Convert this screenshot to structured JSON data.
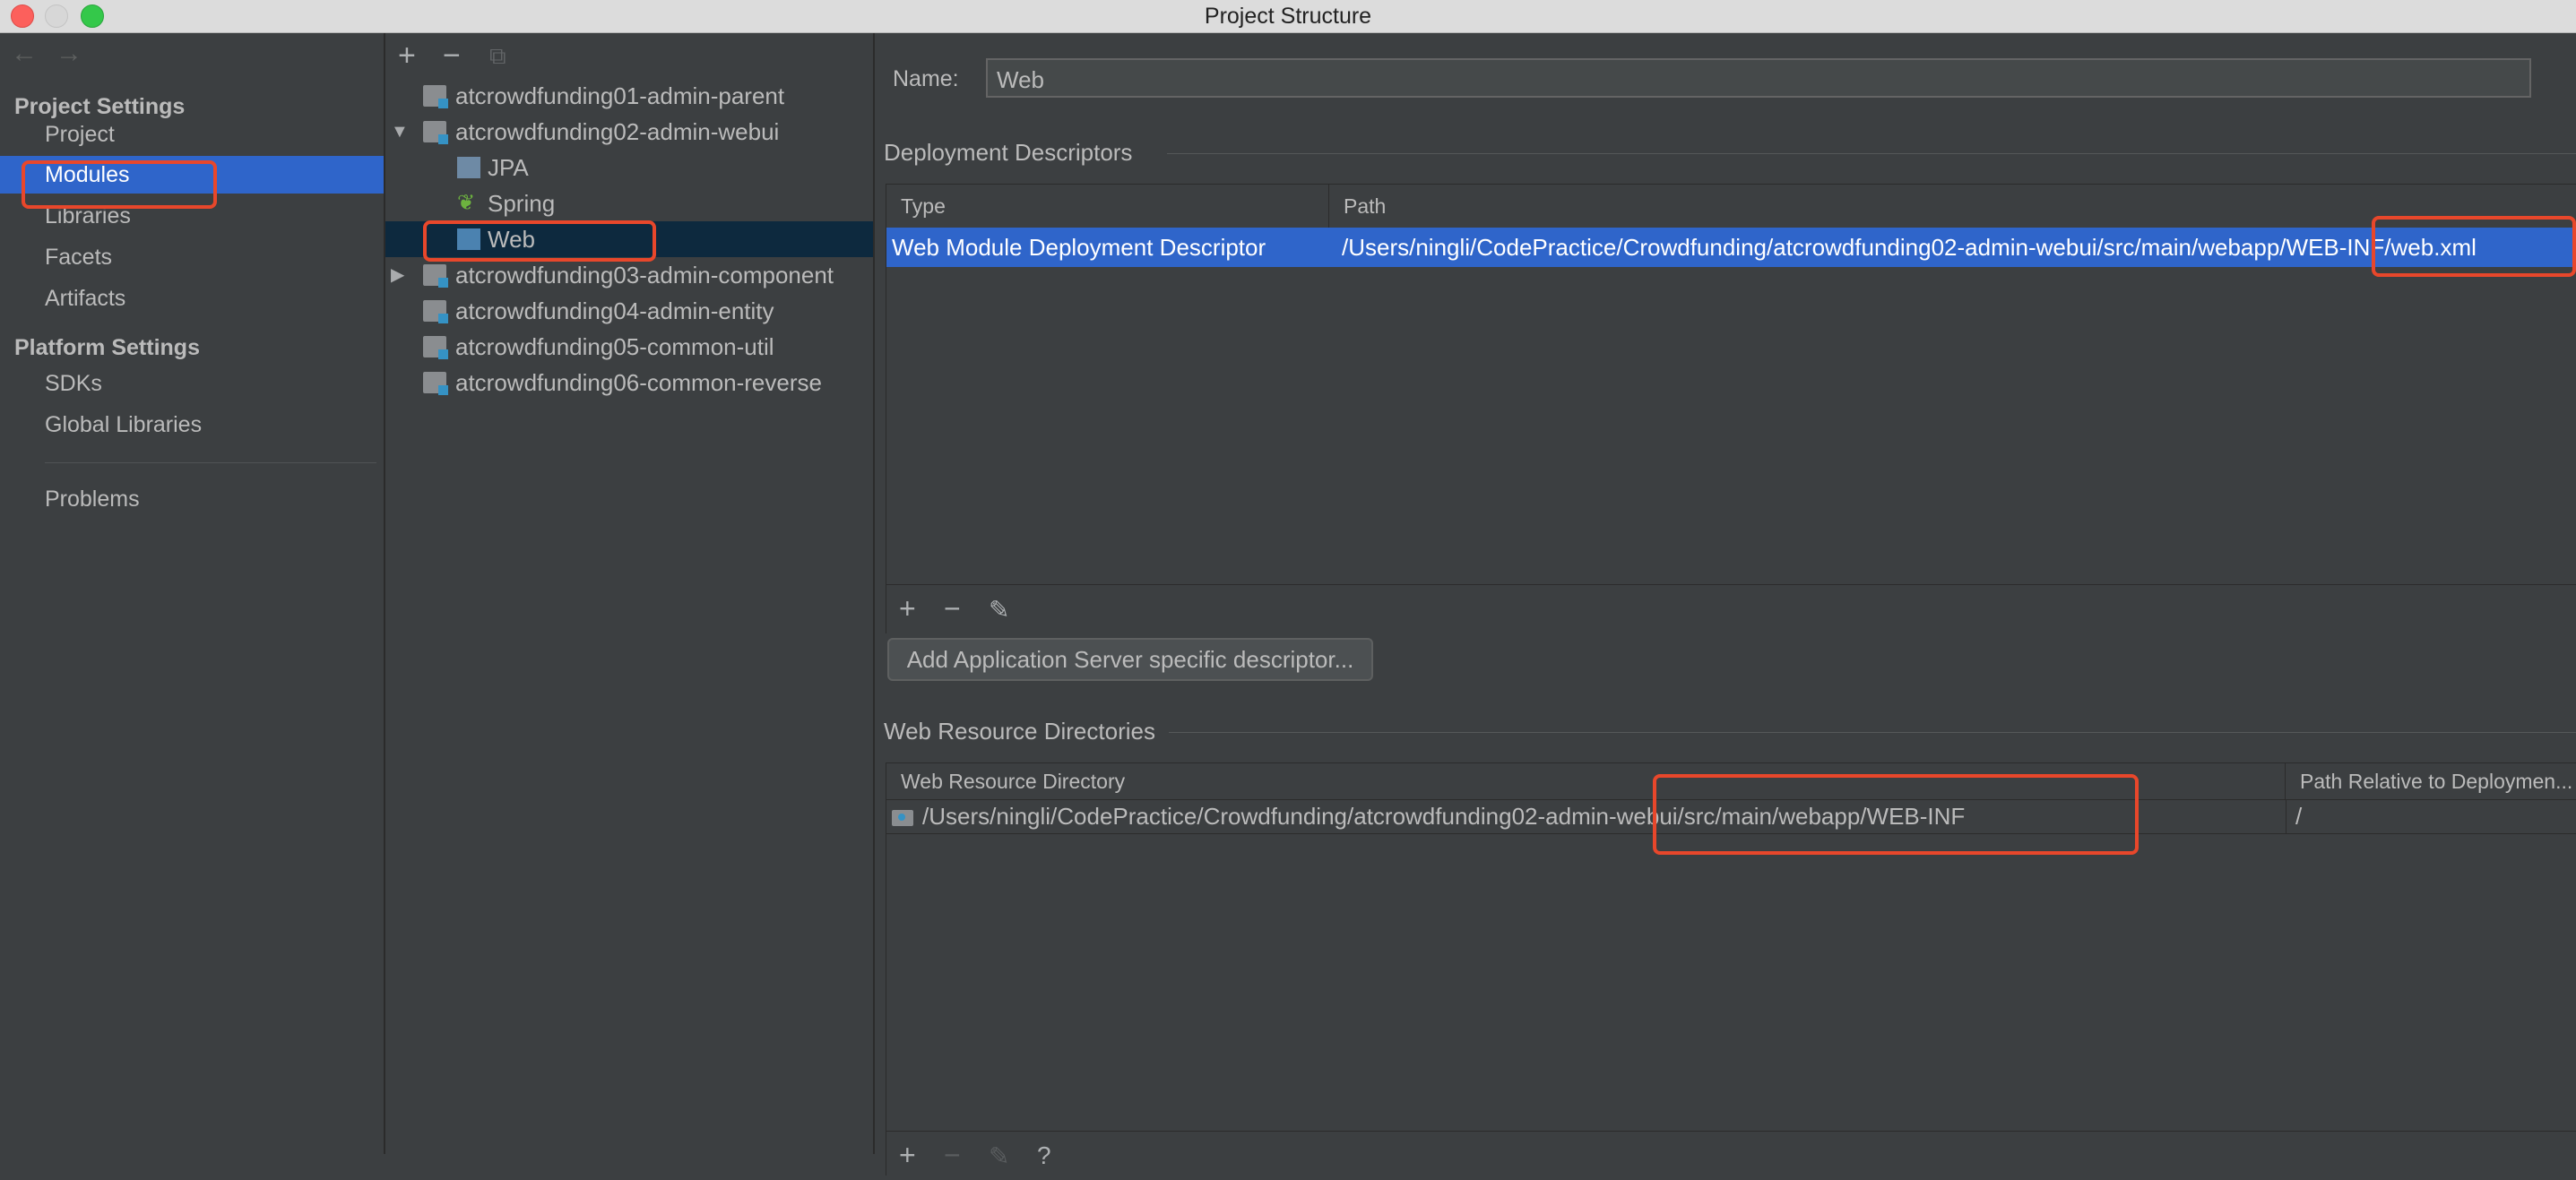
{
  "window": {
    "title": "Project Structure"
  },
  "nav": {
    "back": "←",
    "forward": "→"
  },
  "sidebar": {
    "project_settings_header": "Project Settings",
    "project_settings": [
      "Project",
      "Modules",
      "Libraries",
      "Facets",
      "Artifacts"
    ],
    "platform_settings_header": "Platform Settings",
    "platform_settings": [
      "SDKs",
      "Global Libraries"
    ],
    "problems": "Problems",
    "selected": "Modules"
  },
  "tree_toolbar": {
    "add": "+",
    "remove": "−",
    "copy": "⧉"
  },
  "tree": {
    "items": [
      {
        "label": "atcrowdfunding01-admin-parent",
        "level": 0,
        "expander": ""
      },
      {
        "label": "atcrowdfunding02-admin-webui",
        "level": 0,
        "expander": "▼"
      },
      {
        "label": "JPA",
        "level": 1,
        "expander": ""
      },
      {
        "label": "Spring",
        "level": 1,
        "expander": ""
      },
      {
        "label": "Web",
        "level": 1,
        "expander": ""
      },
      {
        "label": "atcrowdfunding03-admin-component",
        "level": 0,
        "expander": "▶"
      },
      {
        "label": "atcrowdfunding04-admin-entity",
        "level": 0,
        "expander": ""
      },
      {
        "label": "atcrowdfunding05-common-util",
        "level": 0,
        "expander": ""
      },
      {
        "label": "atcrowdfunding06-common-reverse",
        "level": 0,
        "expander": ""
      }
    ],
    "selected": "Web"
  },
  "detail": {
    "name_label": "Name:",
    "name_value": "Web",
    "deployment": {
      "title": "Deployment Descriptors",
      "columns": [
        "Type",
        "Path"
      ],
      "rows": [
        {
          "type": "Web Module Deployment Descriptor",
          "path": "/Users/ningli/CodePractice/Crowdfunding/atcrowdfunding02-admin-webui/src/main/webapp/WEB-INF/web.xml"
        }
      ],
      "footer": {
        "add": "+",
        "remove": "−",
        "edit": "✎"
      }
    },
    "add_server_button": "Add Application Server specific descriptor...",
    "web_resources": {
      "title": "Web Resource Directories",
      "columns": [
        "Web Resource Directory",
        "Path Relative to Deploymen..."
      ],
      "rows": [
        {
          "directory": "/Users/ningli/CodePractice/Crowdfunding/atcrowdfunding02-admin-webui/src/main/webapp/WEB-INF",
          "relative": "/"
        }
      ],
      "footer": {
        "add": "+",
        "remove": "−",
        "edit": "✎",
        "help": "?"
      }
    }
  },
  "colors": {
    "background": "#3c3f41",
    "selection": "#2f65ca",
    "highlight": "#e8472b",
    "text": "#bbbbbb"
  }
}
